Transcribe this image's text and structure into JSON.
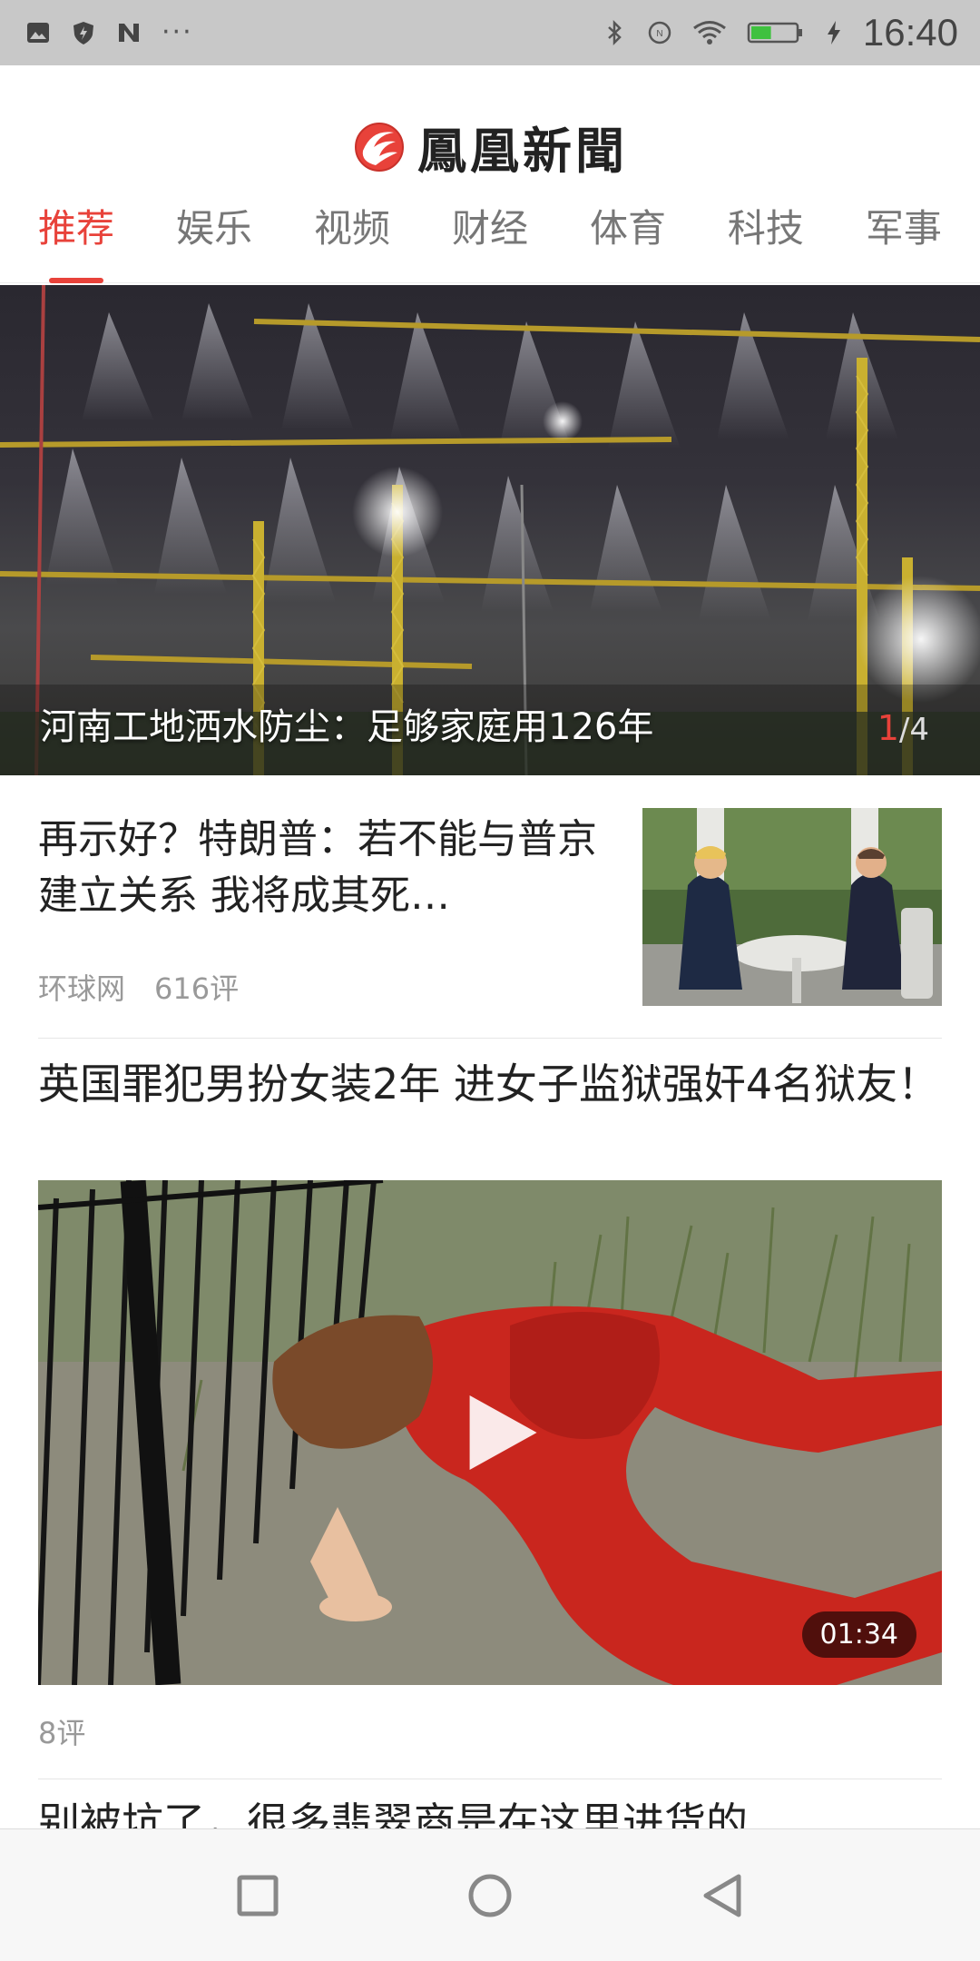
{
  "status_bar": {
    "time": "16:40",
    "left_icons": [
      "image-icon",
      "shield-icon",
      "n-icon"
    ],
    "more": "···",
    "right_icons": [
      "bluetooth-icon",
      "nfc-icon",
      "wifi-icon",
      "battery-icon",
      "charging-icon"
    ],
    "battery_level": 0.45
  },
  "header": {
    "logo_text": "鳳凰新聞",
    "tabs": [
      "推荐",
      "娱乐",
      "视频",
      "财经",
      "体育",
      "科技",
      "军事"
    ],
    "active_tab": 0
  },
  "hero": {
    "caption": "河南工地洒水防尘：足够家庭用126年",
    "counter_current": "1",
    "counter_sep_total": "/4"
  },
  "articles": [
    {
      "title": "再示好？特朗普：若不能与普京建立关系 我将成其死…",
      "source": "环球网",
      "comments": "616评"
    },
    {
      "title": "英国罪犯男扮女装2年 进女子监狱强奸4名狱友！",
      "duration": "01:34",
      "comments": "8评"
    },
    {
      "title": "别被坑了，很多翡翠商是在这里进货的"
    }
  ],
  "nav": {
    "buttons": [
      "recent-apps-button",
      "home-button",
      "back-button"
    ]
  },
  "colors": {
    "accent": "#e8423a",
    "status_bar": "#c8c8c8",
    "battery": "#3fc13f"
  }
}
